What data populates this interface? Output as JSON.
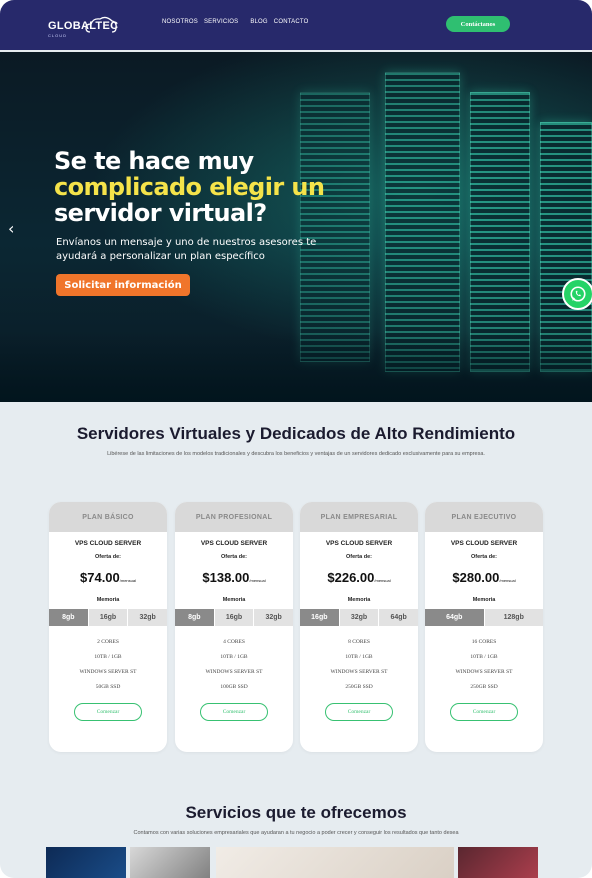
{
  "brand": {
    "name": "GLOBALTEC",
    "tagline": "CLOUD"
  },
  "nav": [
    "NOSOTROS",
    "SERVICIOS",
    "BLOG",
    "CONTACTO"
  ],
  "header_cta": "Contáctanos",
  "hero": {
    "line1": "Se te hace muy",
    "line2": "complicado elegir un",
    "line3": "servidor virtual?",
    "subtitle": "Envíanos un mensaje y uno de nuestros asesores te ayudará a personalizar un plan específico",
    "button": "Solicitar información"
  },
  "plans_section": {
    "title": "Servidores Virtuales y Dedicados de Alto Rendimiento",
    "subtitle": "Libérese de las limitaciones de los modelos tradicionales y descubra los beneficios y ventajas de un servidores dedicado exclusivamente para su empresa."
  },
  "plans": [
    {
      "name": "PLAN BÁSICO",
      "server": "VPS CLOUD SERVER",
      "offer": "Oferta de:",
      "price": "$74.00",
      "period": "/mensual",
      "memory_label": "Memoria",
      "options": [
        "8gb",
        "16gb",
        "32gb"
      ],
      "selected": 0,
      "specs": [
        "2 CORES",
        "10TB / 1GB",
        "WINDOWS SERVER ST",
        "50GB SSD"
      ],
      "button": "Comenzar"
    },
    {
      "name": "PLAN PROFESIONAL",
      "server": "VPS CLOUD SERVER",
      "offer": "Oferta de:",
      "price": "$138.00",
      "period": "/mensual",
      "memory_label": "Memoria",
      "options": [
        "8gb",
        "16gb",
        "32gb"
      ],
      "selected": 0,
      "specs": [
        "4 CORES",
        "10TB / 1GB",
        "WINDOWS SERVER ST",
        "100GB SSD"
      ],
      "button": "Comenzar"
    },
    {
      "name": "PLAN EMPRESARIAL",
      "server": "VPS CLOUD SERVER",
      "offer": "Oferta de:",
      "price": "$226.00",
      "period": "/mensual",
      "memory_label": "Memoria",
      "options": [
        "16gb",
        "32gb",
        "64gb"
      ],
      "selected": 0,
      "specs": [
        "8 CORES",
        "10TB / 1GB",
        "WINDOWS SERVER ST",
        "250GB SSD"
      ],
      "button": "Comenzar"
    },
    {
      "name": "PLAN EJECUTIVO",
      "server": "VPS CLOUD SERVER",
      "offer": "Oferta de:",
      "price": "$280.00",
      "period": "/mensual",
      "memory_label": "Memoria",
      "options": [
        "64gb",
        "128gb"
      ],
      "selected": 0,
      "specs": [
        "16 CORES",
        "10TB / 1GB",
        "WINDOWS SERVER ST",
        "250GB SSD"
      ],
      "button": "Comenzar"
    }
  ],
  "services_section": {
    "title": "Servicios que te ofrecemos",
    "subtitle": "Contamos con varias soluciones empresariales que ayudaran a tu negocio a poder crecer y conseguir los resultados que tanto desea"
  },
  "colors": {
    "header": "#27296b",
    "accent_green": "#2fbf71",
    "hero_button": "#f0752b",
    "highlight": "#f5e34a"
  },
  "icons": [
    "cloud-logo-icon",
    "chevron-left-icon",
    "whatsapp-icon"
  ]
}
